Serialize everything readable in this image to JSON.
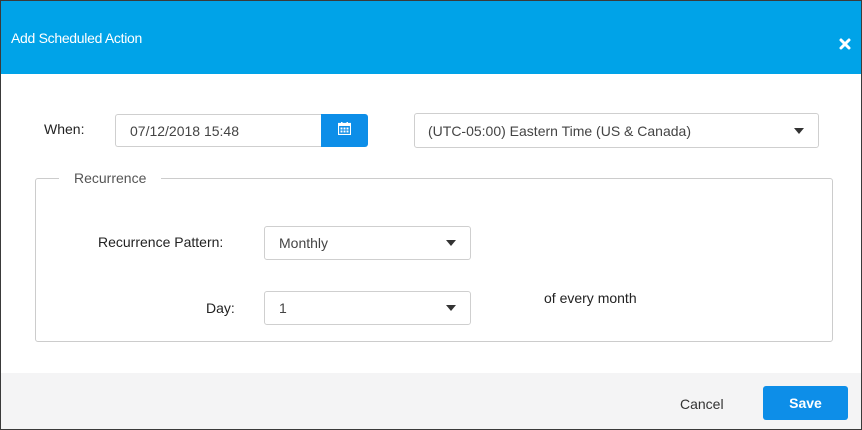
{
  "dialog": {
    "title": "Add Scheduled Action",
    "close_icon": "close-icon"
  },
  "when": {
    "label": "When:",
    "datetime_value": "07/12/2018 15:48",
    "calendar_icon": "calendar-icon",
    "timezone_value": "(UTC-05:00) Eastern Time (US & Canada)"
  },
  "recurrence": {
    "legend": "Recurrence",
    "pattern_label": "Recurrence Pattern:",
    "pattern_value": "Monthly",
    "day_label": "Day:",
    "day_value": "1",
    "day_suffix": "of every month"
  },
  "footer": {
    "cancel_label": "Cancel",
    "save_label": "Save"
  },
  "colors": {
    "header": "#00a3e8",
    "primary_button": "#0d8ee8",
    "footer_bg": "#f4f4f5"
  }
}
